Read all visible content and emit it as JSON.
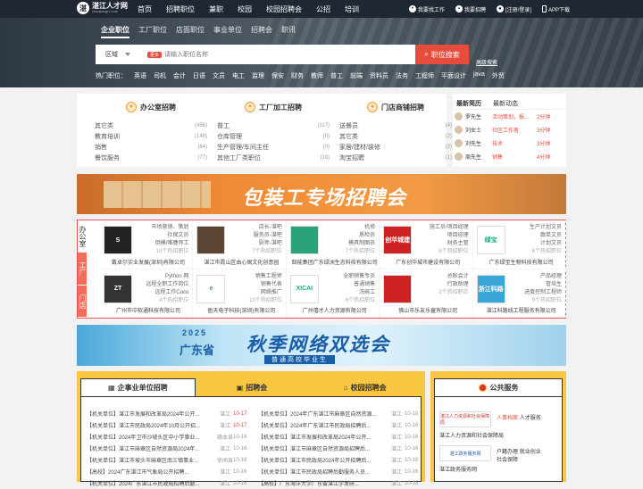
{
  "header": {
    "logo_mark": "湛",
    "logo_cn": "湛江人才网",
    "logo_en": "zhanjiangrc.com",
    "nav": [
      "首页",
      "招聘职位",
      "兼职",
      "校园",
      "校园招聘会",
      "公招",
      "培训"
    ],
    "right": [
      {
        "icon": "user-icon",
        "label": "我要找工作"
      },
      {
        "icon": "briefcase-icon",
        "label": "我要招聘"
      },
      {
        "icon": "account-icon",
        "label": "[注册/登录]"
      },
      {
        "icon": "mobile-icon",
        "label": "APP下载"
      }
    ]
  },
  "search": {
    "tabs": [
      "企业职位",
      "工厂职位",
      "店面职位",
      "事业单位",
      "招聘会",
      "职讯"
    ],
    "area": "区域",
    "badge": "更多",
    "placeholder": "请输入职位名称",
    "button": "职位搜索",
    "advanced": "高级搜索",
    "hot_label": "热门职位：",
    "hot": [
      "英语",
      "司机",
      "会计",
      "日语",
      "文员",
      "电工",
      "监理",
      "保安",
      "财务",
      "教师",
      "普工",
      "前端",
      "资料员",
      "法务",
      "工程师",
      "平面设计",
      "java",
      "外贸"
    ]
  },
  "categories": [
    {
      "title": "办公室招聘",
      "icon": "chair-icon",
      "items": [
        {
          "name": "其它类",
          "count": "(456)"
        },
        {
          "name": "教育培训",
          "count": "(148)"
        },
        {
          "name": "销售",
          "count": "(84)"
        },
        {
          "name": "餐饮服务",
          "count": "(77)"
        }
      ]
    },
    {
      "title": "工厂加工招聘",
      "icon": "factory-icon",
      "items": [
        {
          "name": "普工",
          "count": "(117)"
        },
        {
          "name": "仓库管理",
          "count": "(0)"
        },
        {
          "name": "生产管理/车间主任",
          "count": "(0)"
        },
        {
          "name": "其他工厂类职位",
          "count": "(18)"
        }
      ]
    },
    {
      "title": "门店商铺招聘",
      "icon": "shop-icon",
      "items": [
        {
          "name": "送餐员",
          "count": "(4)"
        },
        {
          "name": "其它类",
          "count": "(2)"
        },
        {
          "name": "家居/建材/装修",
          "count": "(2)"
        },
        {
          "name": "淘宝招聘",
          "count": "(1)"
        }
      ]
    }
  ],
  "news": {
    "tabs": [
      "最新简历",
      "最新动态"
    ],
    "rows": [
      {
        "name": "罗先生",
        "job": "活动策划，报...",
        "time": "2分钟"
      },
      {
        "name": "刘女士",
        "job": "社区工作者",
        "time": "3分钟"
      },
      {
        "name": "刘先生",
        "job": "技术",
        "time": "3分钟"
      },
      {
        "name": "周先生",
        "job": "销售",
        "time": "4分钟"
      }
    ]
  },
  "banner1": {
    "title": "包装工专场招聘会"
  },
  "companies": {
    "side": [
      "办公室",
      "工厂",
      "门店"
    ],
    "list": [
      {
        "jobs": [
          "市场营销、策划",
          "社保文员",
          "倒模/唯睫师工"
        ],
        "more": "10个热招职位",
        "name": "戴卓尔实业发展(深圳)有限公司",
        "logo": "S",
        "color": "#222"
      },
      {
        "jobs": [
          "店长-湛吧",
          "服务员-湛吧",
          "厨师-湛吧"
        ],
        "more": "7个热招职位",
        "name": "湛江市霞山区由心阁文化创意园",
        "logo": "",
        "color": "#5a4632"
      },
      {
        "jobs": [
          "机修",
          "质检员",
          "模具制图员"
        ],
        "more": "7个热招职位",
        "name": "韶能集团广东绿洲生态科技有限公司",
        "logo": "",
        "color": "#2aa37a"
      },
      {
        "jobs": [
          "施工员/项目经理",
          "项目经理",
          "财务主管"
        ],
        "more": "6个热招职位",
        "name": "广东创华城市建设有限公司",
        "logo": "创华城建",
        "color": "#c22"
      },
      {
        "jobs": [
          "生产计划文员",
          "跟单文员",
          "计划文员"
        ],
        "more": "6个热招职位",
        "name": "广东绿宝生物科技有限公司",
        "logo": "绿宝",
        "color": "#fff"
      },
      {
        "jobs": [
          "Python 网",
          "远程全职工作岗位",
          "远程工作Coco"
        ],
        "more": "4个热招职位",
        "name": "广州市中软通科技有限公司",
        "logo": "ZT",
        "color": "#333"
      },
      {
        "jobs": [
          "销售工程师",
          "销售代表",
          "网络推广"
        ],
        "more": "10个热招职位",
        "name": "盈天电子科技(深圳)有限公司",
        "logo": "e",
        "color": "#fff"
      },
      {
        "jobs": [
          "全职销售专员",
          "普通销售",
          "洗碗工"
        ],
        "more": "6个热招职位",
        "name": "广州僖才人力资源有限公司",
        "logo": "XICAI",
        "color": "#fff"
      },
      {
        "jobs": [
          "总账会计",
          "行政助理"
        ],
        "more": "2个热招职位",
        "name": "佛山市乐友乐童有限公司",
        "logo": "",
        "color": "#c22"
      },
      {
        "jobs": [
          "产品经理",
          "管培生",
          "进度控制工程师"
        ],
        "more": "9个热招职位",
        "name": "湛江科路线工程服务有限公司",
        "logo": "浙江科路",
        "color": "#3aa6d6"
      }
    ]
  },
  "banner2": {
    "year": "2025",
    "region": "广东省",
    "title": "秋季网络双选会",
    "subtitle": "普通高校毕业生"
  },
  "jobs": {
    "tabs": [
      "企事业单位招聘",
      "招聘会",
      "校园招聘会"
    ],
    "left": [
      {
        "t": "【机关单位】湛江市发展和改革局2024年公开...",
        "l": "湛江",
        "d": "10-17",
        "red": true
      },
      {
        "t": "【机关单位】湛江市民政局2024年10月公开招...",
        "l": "湛江",
        "d": "10-17",
        "red": true
      },
      {
        "t": "【机关单位】2024年卫市沙坡头区中小学事业...",
        "l": "赣本县",
        "d": "10-16",
        "red": false
      },
      {
        "t": "【机关单位】湛江市麻章区自然资源局2024年...",
        "l": "湛江",
        "d": "10-16",
        "red": false
      },
      {
        "t": "【机关单位】湛江市坡头市麻章区南三镇事业...",
        "l": "徐闻县",
        "d": "10-16",
        "red": false
      },
      {
        "t": "【高校】2024广东湛江市气象局公开招聘...",
        "l": "湛江",
        "d": "10-16",
        "red": false
      },
      {
        "t": "【机关单位】2024广东湛江市民政局招聘后勤...",
        "l": "湛江",
        "d": "10-16",
        "red": false
      }
    ],
    "right": [
      {
        "t": "【机关单位】2024年广东湛江市麻章区自然资源...",
        "l": "湛江",
        "d": "10-16"
      },
      {
        "t": "【机关单位】2024年广东湛江市民政局招聘后...",
        "l": "湛江",
        "d": "10-16"
      },
      {
        "t": "【机关单位】湛江市发展和改革局2024年公开...",
        "l": "湛江",
        "d": "10-16"
      },
      {
        "t": "【机关单位】湛江市麻章区自然资源局招聘后...",
        "l": "湛江",
        "d": "10-16"
      },
      {
        "t": "【机关单位】湛江市民政局2024年公开招聘后...",
        "l": "湛江",
        "d": "10-16"
      },
      {
        "t": "【机关单位】湛江市民政局招聘后勤服务人员...",
        "l": "湛江",
        "d": "10-16"
      },
      {
        "t": "【高校】广东海洋大学广东省湛江学发研...",
        "l": "湛江",
        "d": "10-16"
      }
    ]
  },
  "public": {
    "title": "公共服务",
    "items": [
      {
        "logo": "湛江人力资源和社会保障局",
        "links": [
          [
            "人事档案",
            "人才服务"
          ]
        ],
        "name": "湛江人力资源和社会保障局"
      },
      {
        "logo": "湛江政务服务网",
        "links": [
          [
            "户籍办理",
            "就业创业"
          ],
          [
            "社会保障"
          ]
        ],
        "name": "湛江政务服务网"
      }
    ]
  }
}
